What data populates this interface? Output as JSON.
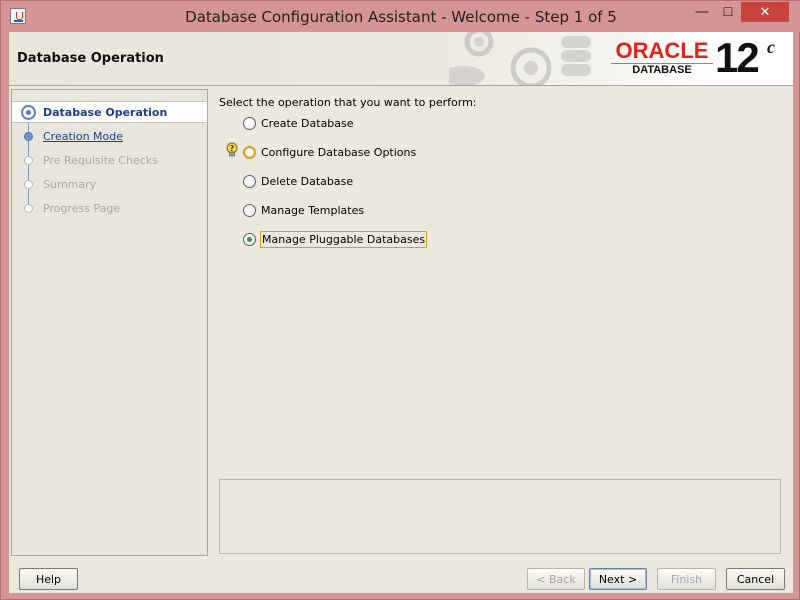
{
  "window": {
    "title": "Database Configuration Assistant - Welcome - Step 1 of 5",
    "controls": {
      "minimize": "—",
      "maximize": "☐",
      "close": "✕"
    }
  },
  "header": {
    "title": "Database Operation",
    "brand": {
      "oracle": "ORACLE",
      "product": "DATABASE",
      "version": "12",
      "version_sup": "c"
    }
  },
  "steps": [
    {
      "label": "Database Operation",
      "state": "current"
    },
    {
      "label": "Creation Mode",
      "state": "link"
    },
    {
      "label": "Pre Requisite Checks",
      "state": "disabled"
    },
    {
      "label": "Summary",
      "state": "disabled"
    },
    {
      "label": "Progress Page",
      "state": "disabled"
    }
  ],
  "content": {
    "prompt": "Select the operation that you want to perform:",
    "options": [
      {
        "label": "Create Database",
        "selected": false
      },
      {
        "label": "Configure Database Options",
        "selected": false
      },
      {
        "label": "Delete Database",
        "selected": false
      },
      {
        "label": "Manage Templates",
        "selected": false
      },
      {
        "label": "Manage Pluggable Databases",
        "selected": true
      }
    ]
  },
  "buttons": {
    "help": "Help",
    "back": "< Back",
    "next": "Next >",
    "finish": "Finish",
    "cancel": "Cancel"
  },
  "colors": {
    "oracle_red": "#e2231a",
    "link_blue": "#1b3f8b",
    "focus_amber": "#d89f18",
    "title_bar": "#d59596",
    "close_red": "#c7433b"
  }
}
